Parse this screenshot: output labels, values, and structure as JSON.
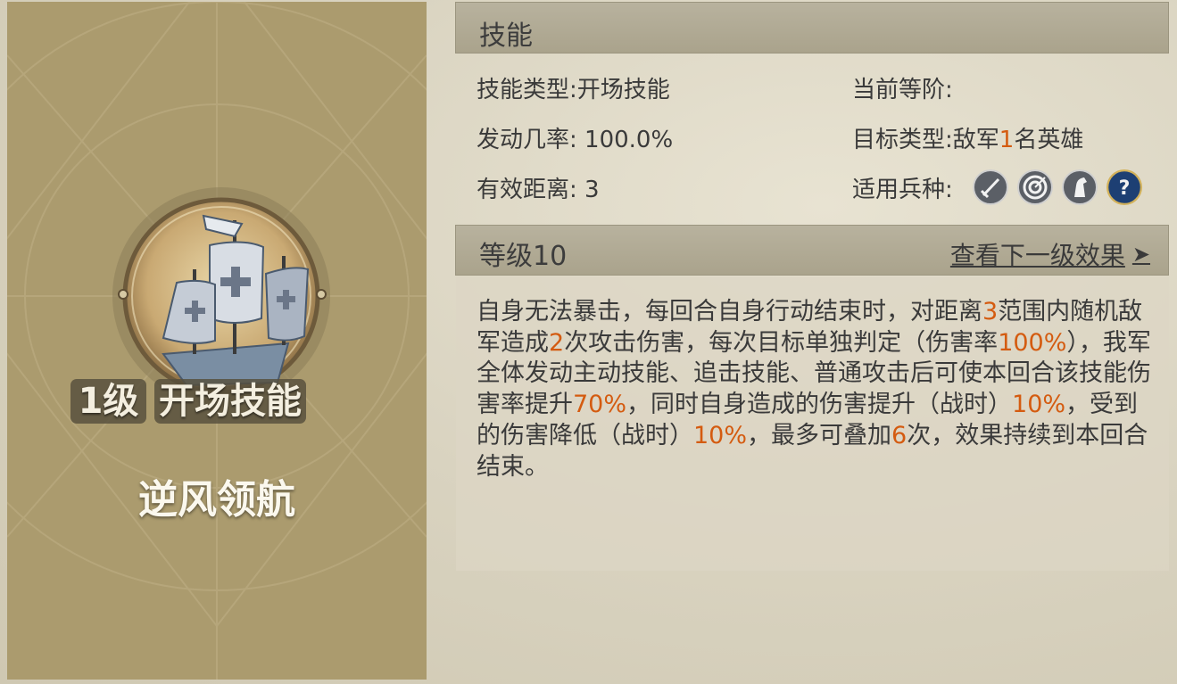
{
  "left_card": {
    "level_tag": "1级",
    "type_tag": "开场技能",
    "skill_name": "逆风领航",
    "emblem_icon": "ship-emblem-icon"
  },
  "skill_section": {
    "title": "技能",
    "skill_type_label": "技能类型:",
    "skill_type_value": "开场技能",
    "current_rank_label": "当前等阶:",
    "current_rank_value": "",
    "trigger_rate_label": "发动几率:",
    "trigger_rate_value": "100.0%",
    "target_type_label": "目标类型:",
    "target_type_prefix": "敌军",
    "target_type_count": "1",
    "target_type_suffix": "名英雄",
    "range_label": "有效距离:",
    "range_value": "3",
    "troop_type_label": "适用兵种:",
    "troop_icons": [
      "sword-icon",
      "target-archer-icon",
      "horse-cavalry-icon",
      "question-icon"
    ]
  },
  "level_section": {
    "title": "等级10",
    "next_level_link": "查看下一级效果",
    "arrow": "➤"
  },
  "description": {
    "segments": [
      {
        "text": "自身无法暴击，每回合自身行动结束时，对距离",
        "hl": false
      },
      {
        "text": "3",
        "hl": true
      },
      {
        "text": "范围内随机敌军造成",
        "hl": false
      },
      {
        "text": "2",
        "hl": true
      },
      {
        "text": "次攻击伤害，每次目标单独判定（伤害率",
        "hl": false
      },
      {
        "text": "100%",
        "hl": true
      },
      {
        "text": "），我军全体发动主动技能、追击技能、普通攻击后可使本回合该技能伤害率提升",
        "hl": false
      },
      {
        "text": "70%",
        "hl": true
      },
      {
        "text": "，同时自身造成的伤害提升（战时）",
        "hl": false
      },
      {
        "text": "10%",
        "hl": true
      },
      {
        "text": "，受到的伤害降低（战时）",
        "hl": false
      },
      {
        "text": "10%",
        "hl": true
      },
      {
        "text": "，最多可叠加",
        "hl": false
      },
      {
        "text": "6",
        "hl": true
      },
      {
        "text": "次，效果持续到本回合结束。",
        "hl": false
      }
    ]
  },
  "colors": {
    "highlight": "#d45b10",
    "card_bg": "#ab9b6e",
    "bar_bg": "#b0aa94"
  }
}
